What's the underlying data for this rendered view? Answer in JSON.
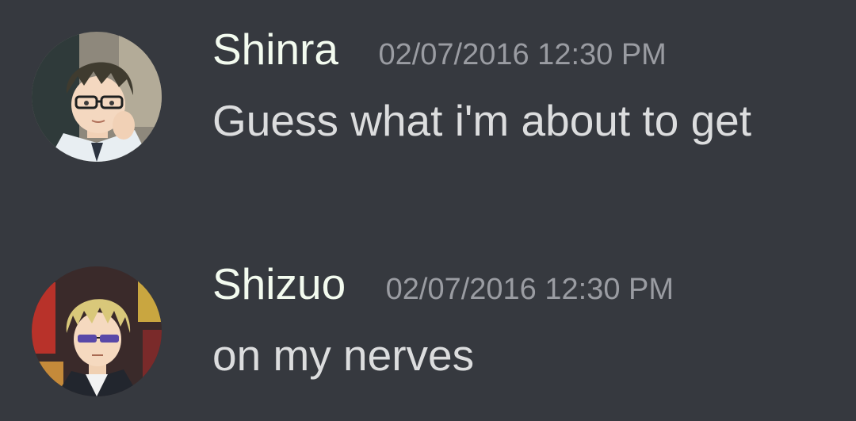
{
  "messages": [
    {
      "username": "Shinra",
      "timestamp": "02/07/2016 12:30 PM",
      "text": "Guess what i'm about to get",
      "avatar_icon": "user-avatar-icon"
    },
    {
      "username": "Shizuo",
      "timestamp": "02/07/2016 12:30 PM",
      "text": "on my nerves",
      "avatar_icon": "user-avatar-icon"
    }
  ],
  "colors": {
    "background": "#36393f",
    "username": "#f3fbef",
    "timestamp": "#9a9ca2",
    "message_text": "#dcddde"
  }
}
